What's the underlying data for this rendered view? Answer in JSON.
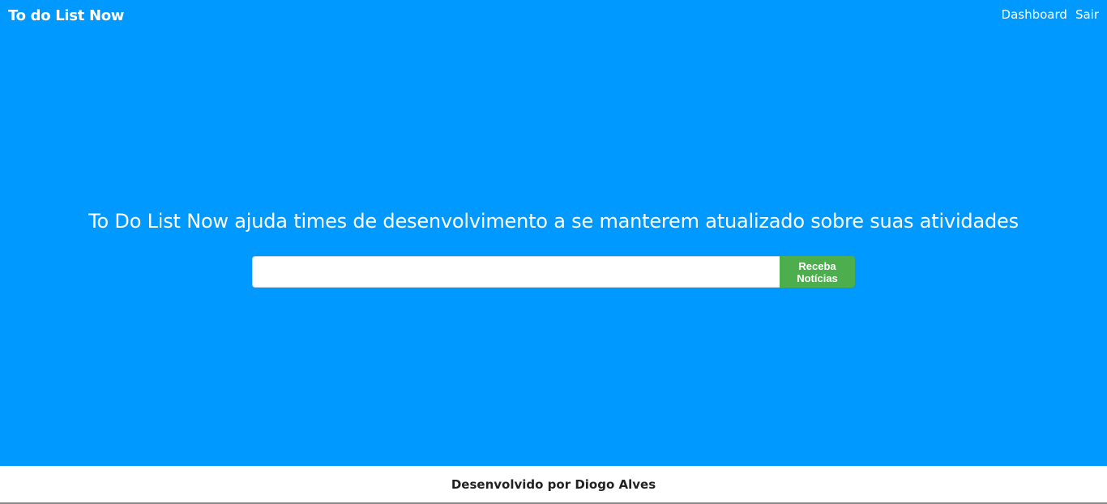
{
  "header": {
    "brand": "To do List Now",
    "nav": {
      "dashboard": "Dashboard",
      "logout": "Sair"
    }
  },
  "hero": {
    "headline": "To Do List Now ajuda times de desenvolvimento a se manterem atualizado sobre suas atividades",
    "signup": {
      "input_value": "",
      "input_placeholder": "",
      "button_label": "Receba Notícias"
    }
  },
  "footer": {
    "credit": "Desenvolvido por Diogo Alves"
  },
  "colors": {
    "hero_background": "#0099ff",
    "button_background": "#4cae4c",
    "footer_background": "#ffffff"
  }
}
